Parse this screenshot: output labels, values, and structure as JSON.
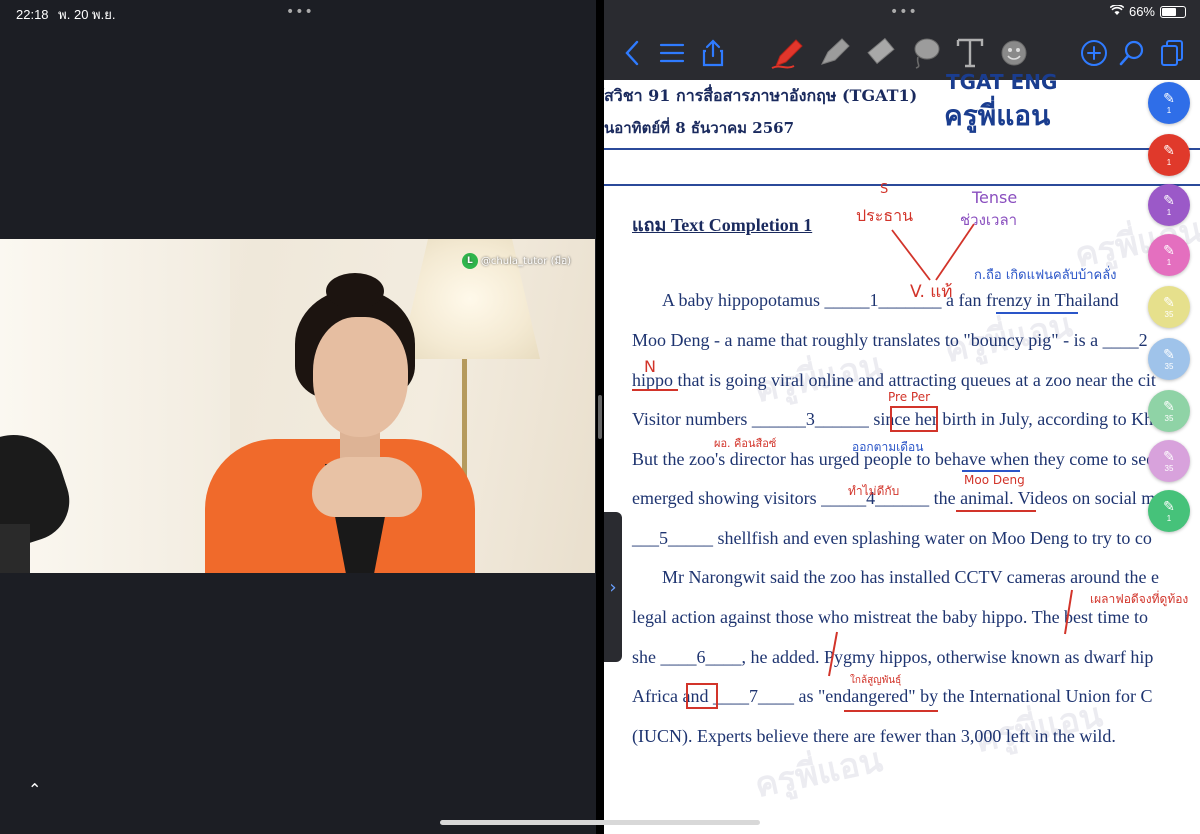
{
  "status": {
    "time": "22:18",
    "date": "พ. 20 พ.ย.",
    "battery": "66%"
  },
  "video": {
    "handle": "@chula_tutor (มีอ)"
  },
  "toolbar": {
    "back_icon": "chevron-left-icon",
    "colors": {
      "toolbar_bg": "#2a2b30",
      "icon_blue": "#2f7bff",
      "pen_red": "#e2362b"
    }
  },
  "doc": {
    "course": "ัสวิชา 91 การสื่อสารภาษาอังกฤษ (TGAT1)",
    "date": "นอาทิตย์ที่ 8 ธันวาคม 2567",
    "logo_line1": "TGAT ENG",
    "logo_line2": "ครูพี่แอน",
    "section_title": "แถม Text Completion 1",
    "lines": [
      "A baby hippopotamus _____1_______ a fan frenzy in Thailand",
      "Moo Deng - a name that roughly translates to \"bouncy pig\" - is a ____2",
      "hippo that is going viral online and attracting queues at a zoo near the cit",
      "Visitor numbers ______3______ since her birth in July, according to Kha",
      "But the zoo's director has urged people to behave when they come to see",
      "emerged showing visitors _____4______ the animal. Videos on social me",
      "___5_____ shellfish and even splashing water on Moo Deng to try to co",
      "Mr Narongwit said the zoo has installed CCTV cameras around the e",
      "legal action against those who mistreat the baby hippo. The best time to",
      "she ____6____, he added. Pygmy hippos, otherwise known as dwarf hip",
      "Africa and ____7____ as \"endangered\" by the International Union for C",
      "(IUCN). Experts believe there are fewer than 3,000 left in the wild."
    ],
    "annotations": {
      "s_label": "S",
      "subject": "ประธาน",
      "tense": "Tense",
      "tense_th": "ช่วงเวลา",
      "verb": "V. แท้",
      "meaning1": "ก.ถือ เกิดแฟนคลับบ้าคลั่ง",
      "n_label": "N",
      "pre_per": "Pre Per",
      "note3a": "ผอ. คือนสือซ์",
      "note3b": "ออกตามเดือน",
      "moo_deng": "Moo Deng",
      "note4": "ทำไม่ดีกับ",
      "note8": "เผลาฟอดีจงที่ดูท้อง",
      "note10": "ใกล้สูญพันธุ์"
    },
    "watermark": "ครูพี่แอน"
  },
  "pens": [
    {
      "color": "#2f6ee8",
      "count": "1"
    },
    {
      "color": "#e0392b",
      "count": "1"
    },
    {
      "color": "#9b59c8",
      "count": "1"
    },
    {
      "color": "#e46fbf",
      "count": "1"
    },
    {
      "color": "#e6e08c",
      "count": "35"
    },
    {
      "color": "#9fc3ea",
      "count": "35"
    },
    {
      "color": "#8fd3a6",
      "count": "35"
    },
    {
      "color": "#d8a2dc",
      "count": "35"
    },
    {
      "color": "#46c27a",
      "count": "1"
    }
  ]
}
